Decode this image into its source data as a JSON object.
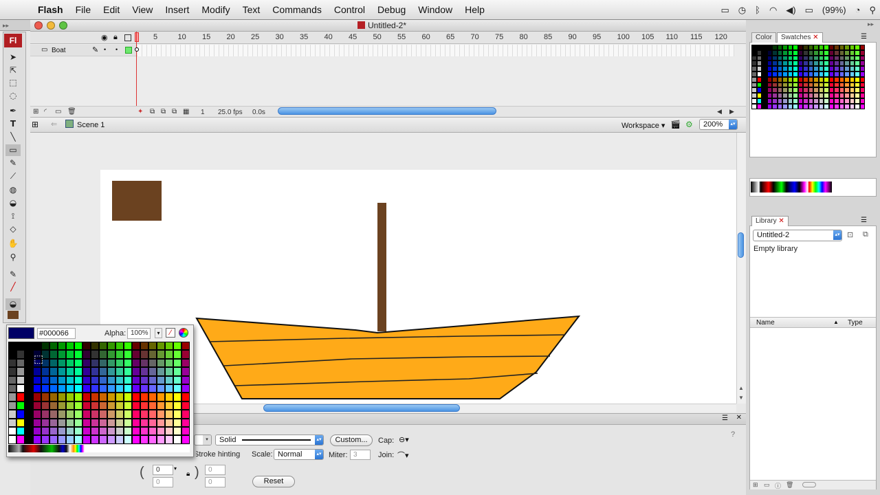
{
  "menubar": {
    "app": "Flash",
    "items": [
      "File",
      "Edit",
      "View",
      "Insert",
      "Modify",
      "Text",
      "Commands",
      "Control",
      "Debug",
      "Window",
      "Help"
    ],
    "battery": "(99%)"
  },
  "document": {
    "title": "Untitled-2*"
  },
  "tools_panel": {
    "logo": "Fl"
  },
  "timeline": {
    "frame_numbers": [
      "5",
      "10",
      "15",
      "20",
      "25",
      "30",
      "35",
      "40",
      "45",
      "50",
      "55",
      "60",
      "65",
      "70",
      "75",
      "80",
      "85",
      "90",
      "95",
      "100",
      "105",
      "110",
      "115",
      "120"
    ],
    "layer_name": "Boat",
    "status": {
      "current_frame": "1",
      "fps": "25.0 fps",
      "time": "0.0s"
    }
  },
  "editbar": {
    "scene": "Scene 1",
    "workspace": "Workspace",
    "zoom": "200%"
  },
  "picker": {
    "hex": "#000066",
    "alpha_label": "Alpha:",
    "alpha_value": "100%",
    "selected_color": "#000066"
  },
  "properties": {
    "stroke_style": "Solid",
    "custom_button": "Custom...",
    "cap_label": "Cap:",
    "hinting_label": "Stroke hinting",
    "scale_label": "Scale:",
    "scale_value": "Normal",
    "miter_label": "Miter:",
    "miter_value": "3",
    "join_label": "Join:",
    "x_value": "0",
    "y_value": "0",
    "w_value": "0",
    "h_value": "0",
    "reset_button": "Reset"
  },
  "color_panel": {
    "tab_color": "Color",
    "tab_swatches": "Swatches"
  },
  "library_panel": {
    "tab": "Library",
    "document": "Untitled-2",
    "empty_text": "Empty library",
    "col_name": "Name",
    "col_type": "Type"
  },
  "stage_colors": {
    "rect": "#6b4220",
    "mast": "#6b4220",
    "hull": "#ffaa18",
    "plank": "#333333"
  }
}
